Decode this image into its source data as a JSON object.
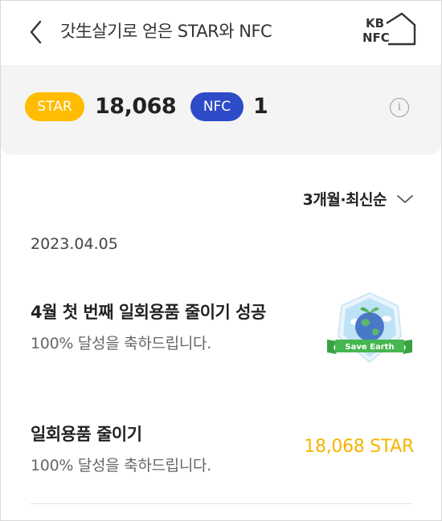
{
  "header": {
    "title": "갓生살기로 얻은 STAR와 NFC",
    "logo_line1": "KB",
    "logo_line2": "NFC"
  },
  "summary": {
    "star_label": "STAR",
    "star_value": "18,068",
    "nfc_label": "NFC",
    "nfc_value": "1",
    "star_color": "#ffbc00",
    "nfc_color": "#2e4bc8"
  },
  "filter": {
    "label": "3개월·최신순"
  },
  "history": {
    "date": "2023.04.05",
    "items": [
      {
        "title": "4월 첫 번째 일회용품 줄이기 성공",
        "subtitle": "100% 달성을 축하드립니다.",
        "badge_text": "Save Earth"
      },
      {
        "title": "일회용품 줄이기",
        "subtitle": "100% 달성을 축하드립니다.",
        "amount": "18,068 STAR",
        "amount_color": "#f5b400"
      }
    ]
  }
}
